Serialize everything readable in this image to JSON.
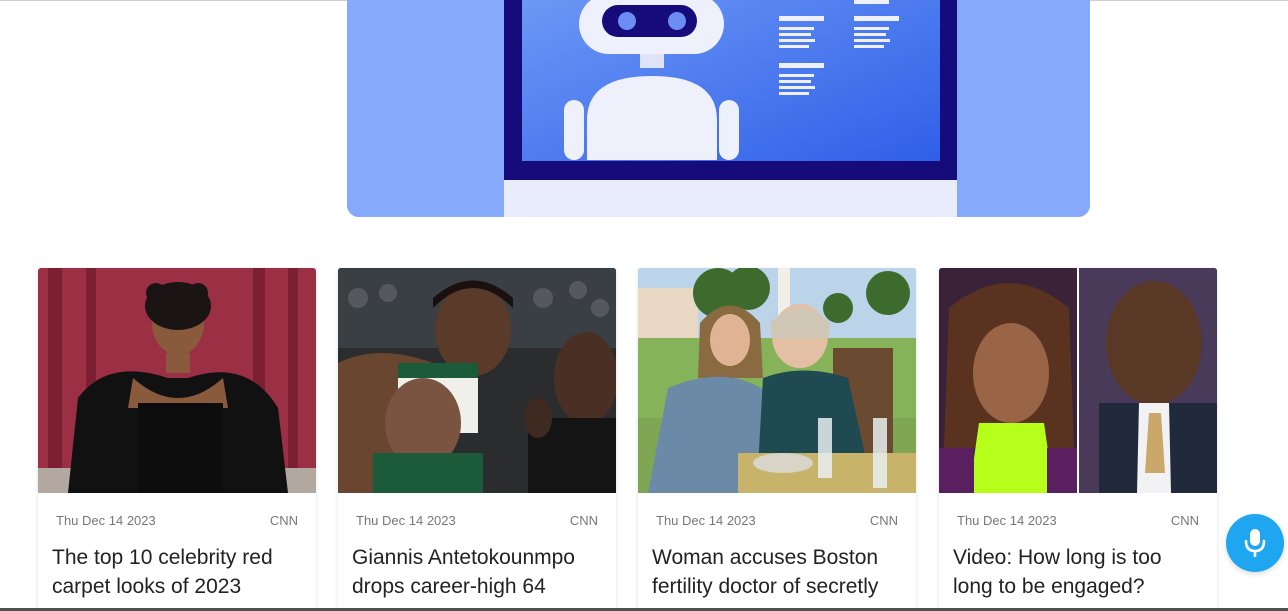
{
  "hero": {
    "image_name": "robot-computer-illustration",
    "colors": {
      "background": "#86a9fb",
      "screen_frame": "#150b7a",
      "screen": "#3c70ef",
      "robot": "#eef0fb"
    }
  },
  "cards": [
    {
      "date": "Thu Dec 14 2023",
      "source": "CNN",
      "title": "The top 10 celebrity red carpet looks of 2023"
    },
    {
      "date": "Thu Dec 14 2023",
      "source": "CNN",
      "title": "Giannis Antetokounmpo drops career-high 64"
    },
    {
      "date": "Thu Dec 14 2023",
      "source": "CNN",
      "title": "Woman accuses Boston fertility doctor of secretly"
    },
    {
      "date": "Thu Dec 14 2023",
      "source": "CNN",
      "title": "Video: How long is too long to be engaged?"
    }
  ],
  "mic": {
    "icon": "microphone-icon",
    "color": "#1ea7f0"
  }
}
